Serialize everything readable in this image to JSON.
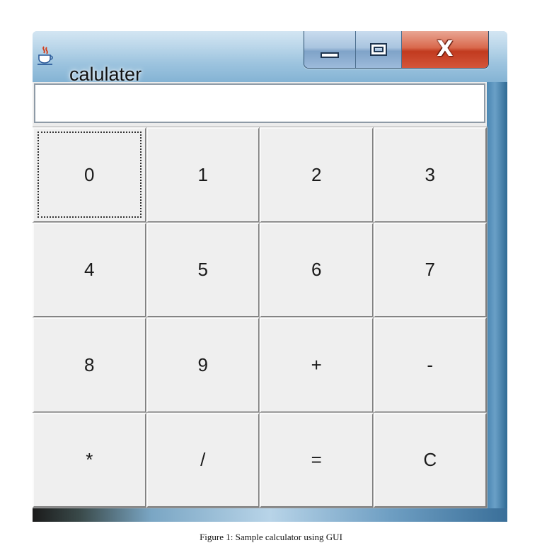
{
  "window": {
    "title": "calulater",
    "app_icon": "java-cup-icon",
    "caption_buttons": {
      "minimize_icon": "minimize-icon",
      "maximize_icon": "maximize-icon",
      "close_icon": "close-icon",
      "close_glyph": "X"
    }
  },
  "display": {
    "value": ""
  },
  "keypad": {
    "rows": [
      [
        "0",
        "1",
        "2",
        "3"
      ],
      [
        "4",
        "5",
        "6",
        "7"
      ],
      [
        "8",
        "9",
        "+",
        "-"
      ],
      [
        "*",
        "/",
        "=",
        "C"
      ]
    ],
    "focused_key": "0"
  },
  "caption": "Figure 1: Sample calculator using GUI",
  "colors": {
    "frame": "#4e8bb6",
    "client_bg": "#ececec",
    "key_bg": "#efefef",
    "close_button": "#c13a1f"
  }
}
